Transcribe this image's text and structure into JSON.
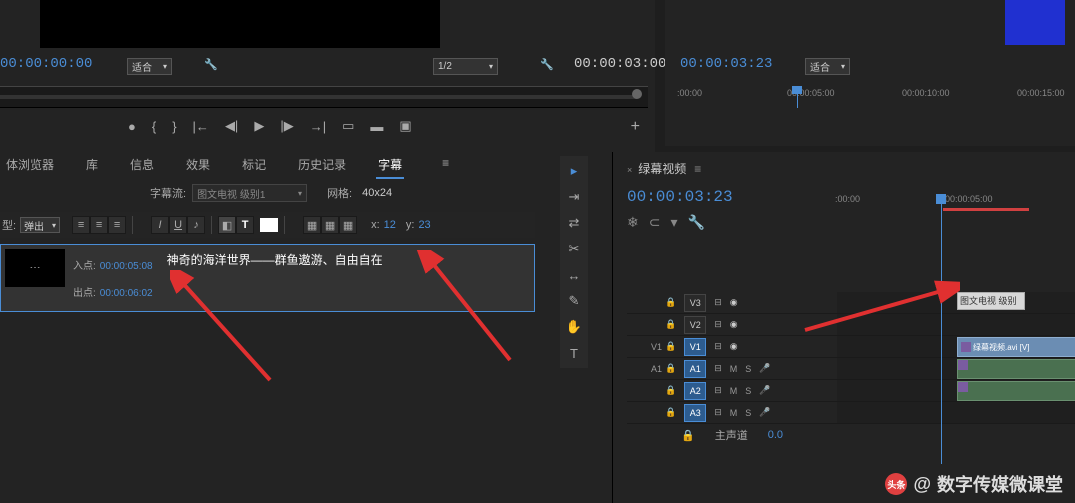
{
  "source": {
    "timecode_in": "00:00:00:00",
    "fit": "适合",
    "zoom": "1/2",
    "timecode_out": "00:00:03:00"
  },
  "ruler_right": {
    "t0": ":00:00",
    "t1": "00:00:05:00",
    "t2": "00:00:10:00",
    "t3": "00:00:15:00"
  },
  "program": {
    "timecode": "00:00:03:23",
    "fit": "适合"
  },
  "tabs": {
    "media": "体浏览器",
    "lib": "库",
    "info": "信息",
    "effects": "效果",
    "markers": "标记",
    "history": "历史记录",
    "captions": "字幕"
  },
  "caption": {
    "stream_label": "字幕流:",
    "stream": "图文电视 级别1",
    "grid_label": "网格:",
    "grid_val": "40x24",
    "type_label": "型:",
    "type_val": "弹出",
    "x_label": "x:",
    "x_val": "12",
    "y_label": "y:",
    "y_val": "23"
  },
  "clip": {
    "in_label": "入点:",
    "in_tc": "00:00:05:08",
    "out_label": "出点:",
    "out_tc": "00:00:06:02",
    "text": "神奇的海洋世界——群鱼遨游、自由自在"
  },
  "timeline": {
    "name": "绿幕视频",
    "timecode": "00:00:03:23",
    "ruler_t0": ":00:00",
    "ruler_t1": "00:00:05:00",
    "tracks": {
      "v3": "V3",
      "v2": "V2",
      "v1": "V1",
      "v1src": "V1",
      "a1": "A1",
      "a1src": "A1",
      "a2": "A2",
      "a3": "A3",
      "mix": "主声道",
      "mix_val": "0.0"
    },
    "clip_title": "图文电视 级别",
    "clip_video": "绿幕视频.avi [V]",
    "audio_ctrl": {
      "m": "M",
      "s": "S"
    }
  },
  "watermark": {
    "at": "@",
    "text": "数字传媒微课堂",
    "logo": "头条"
  }
}
